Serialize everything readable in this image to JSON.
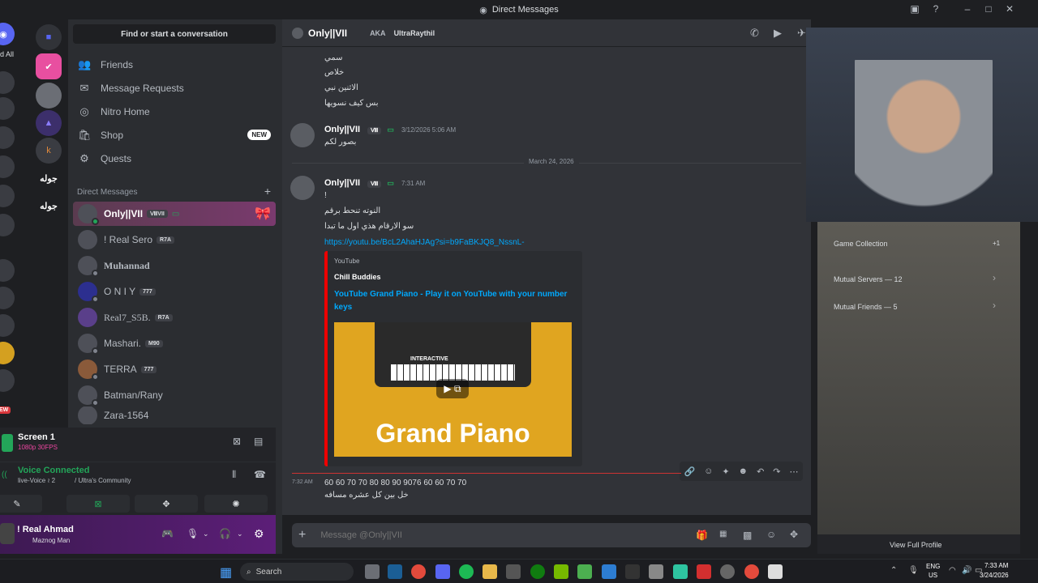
{
  "window": {
    "title": "Direct Messages"
  },
  "rail_edge": {
    "all_label": "d All",
    "new_label": "EW"
  },
  "rail": {
    "items": [
      "جوله",
      "جوله"
    ]
  },
  "sidebar": {
    "search": "Find or start a conversation",
    "nav": [
      {
        "label": "Friends",
        "icon": "friends-icon",
        "glyph": "👥"
      },
      {
        "label": "Message Requests",
        "icon": "mail-icon",
        "glyph": "✉"
      },
      {
        "label": "Nitro Home",
        "icon": "nitro-icon",
        "glyph": "◎"
      },
      {
        "label": "Shop",
        "icon": "shop-icon",
        "glyph": "🛍",
        "badge": "NEW"
      },
      {
        "label": "Quests",
        "icon": "quests-icon",
        "glyph": "⚙"
      }
    ],
    "dm_header": "Direct Messages",
    "dms": [
      {
        "name": "Only||VII",
        "tag": "ⅧVII"
      },
      {
        "name": "! Real Sero",
        "tag": "R7A"
      },
      {
        "name": "Muhannad",
        "tag": ""
      },
      {
        "name": "O N I Y",
        "tag": "777"
      },
      {
        "name": "Real7_S5B.",
        "tag": "R7A"
      },
      {
        "name": "Mashari.",
        "tag": "M90"
      },
      {
        "name": "TERRA",
        "tag": "777"
      },
      {
        "name": "Batman/Rany",
        "tag": ""
      },
      {
        "name": "Zara-1564",
        "tag": ""
      }
    ]
  },
  "stream": {
    "title": "Screen 1",
    "quality": "1080p 30FPS"
  },
  "voice": {
    "status": "Voice Connected",
    "channel": "live-Voice ≀ 2",
    "server": "/ Ultra's Community"
  },
  "user": {
    "name": "! Real Ahmad",
    "status": "Maznog Man"
  },
  "chat_header": {
    "name": "Only||VII",
    "aka_label": "AKA",
    "aka": "UltraRaythil"
  },
  "messages": {
    "top_lines": [
      "سمي",
      "خلاص",
      "الاثنين نبي",
      "بس كيف نسويها"
    ],
    "m1": {
      "author": "Only||VII",
      "time": "3/12/2026 5:06 AM",
      "text": "بصور لكم"
    },
    "date_sep": "March 24, 2026",
    "m2": {
      "author": "Only||VII",
      "time": "7:31 AM",
      "lines": [
        "!",
        "النوته تنحط برقم",
        "سو الارقام هذي اول ما تبدا"
      ],
      "link": "https://youtu.be/BcL2AhaHJAg?si=b9FaBKJQ8_NssnL-"
    },
    "embed": {
      "provider": "YouTube",
      "author": "Chill Buddies",
      "title": "YouTube Grand Piano - Play it on YouTube with your number keys",
      "thumb_text": "Grand Piano",
      "thumb_sub": "INTERACTIVE"
    },
    "m3": {
      "time": "7:32 AM",
      "numbers": "60 60 70 70 80 80 90 9076 60 60 70 70",
      "text": "خل بين كل عشره مسافه"
    }
  },
  "composer": {
    "placeholder": "Message @Only||VII"
  },
  "profile": {
    "rows": [
      "Game Collection",
      "Mutual Servers — 12",
      "Mutual Friends — 5"
    ],
    "game_count": "+1",
    "view_full": "View Full Profile"
  },
  "taskbar": {
    "search": "Search",
    "lang": "ENG",
    "region": "US",
    "time": "7:33 AM",
    "date": "3/24/2026"
  },
  "colors": {
    "accent": "#5865f2",
    "online": "#23a559",
    "link": "#00a8fc",
    "embed_bar": "#ee0000"
  }
}
